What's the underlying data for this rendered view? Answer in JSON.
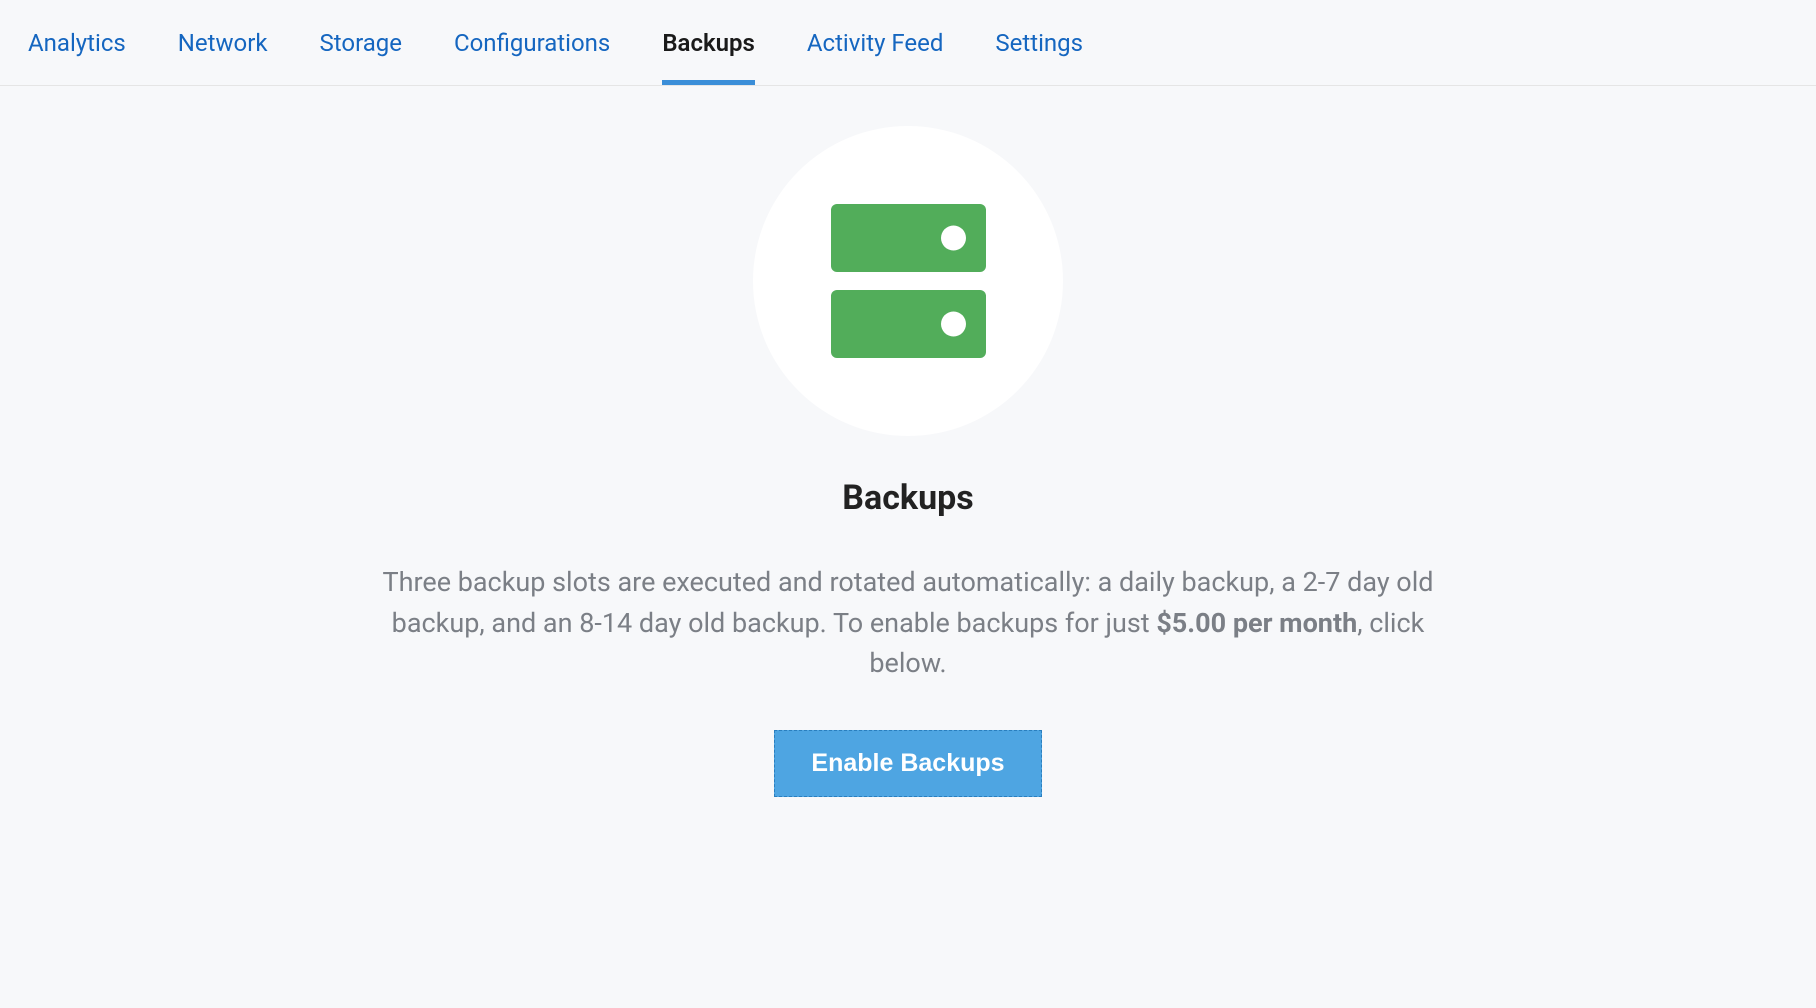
{
  "tabs": [
    {
      "label": "Analytics",
      "active": false
    },
    {
      "label": "Network",
      "active": false
    },
    {
      "label": "Storage",
      "active": false
    },
    {
      "label": "Configurations",
      "active": false
    },
    {
      "label": "Backups",
      "active": true
    },
    {
      "label": "Activity Feed",
      "active": false
    },
    {
      "label": "Settings",
      "active": false
    }
  ],
  "main": {
    "heading": "Backups",
    "description_part1": "Three backup slots are executed and rotated automatically: a daily backup, a 2-7 day old backup, and an 8-14 day old backup. To enable backups for just ",
    "price": "$5.00 per month",
    "description_part2": ", click below.",
    "button_label": "Enable Backups"
  },
  "colors": {
    "link": "#1566c0",
    "active_underline": "#3b8ed8",
    "server_green": "#52ad5a",
    "button_blue": "#4ea5e2"
  }
}
